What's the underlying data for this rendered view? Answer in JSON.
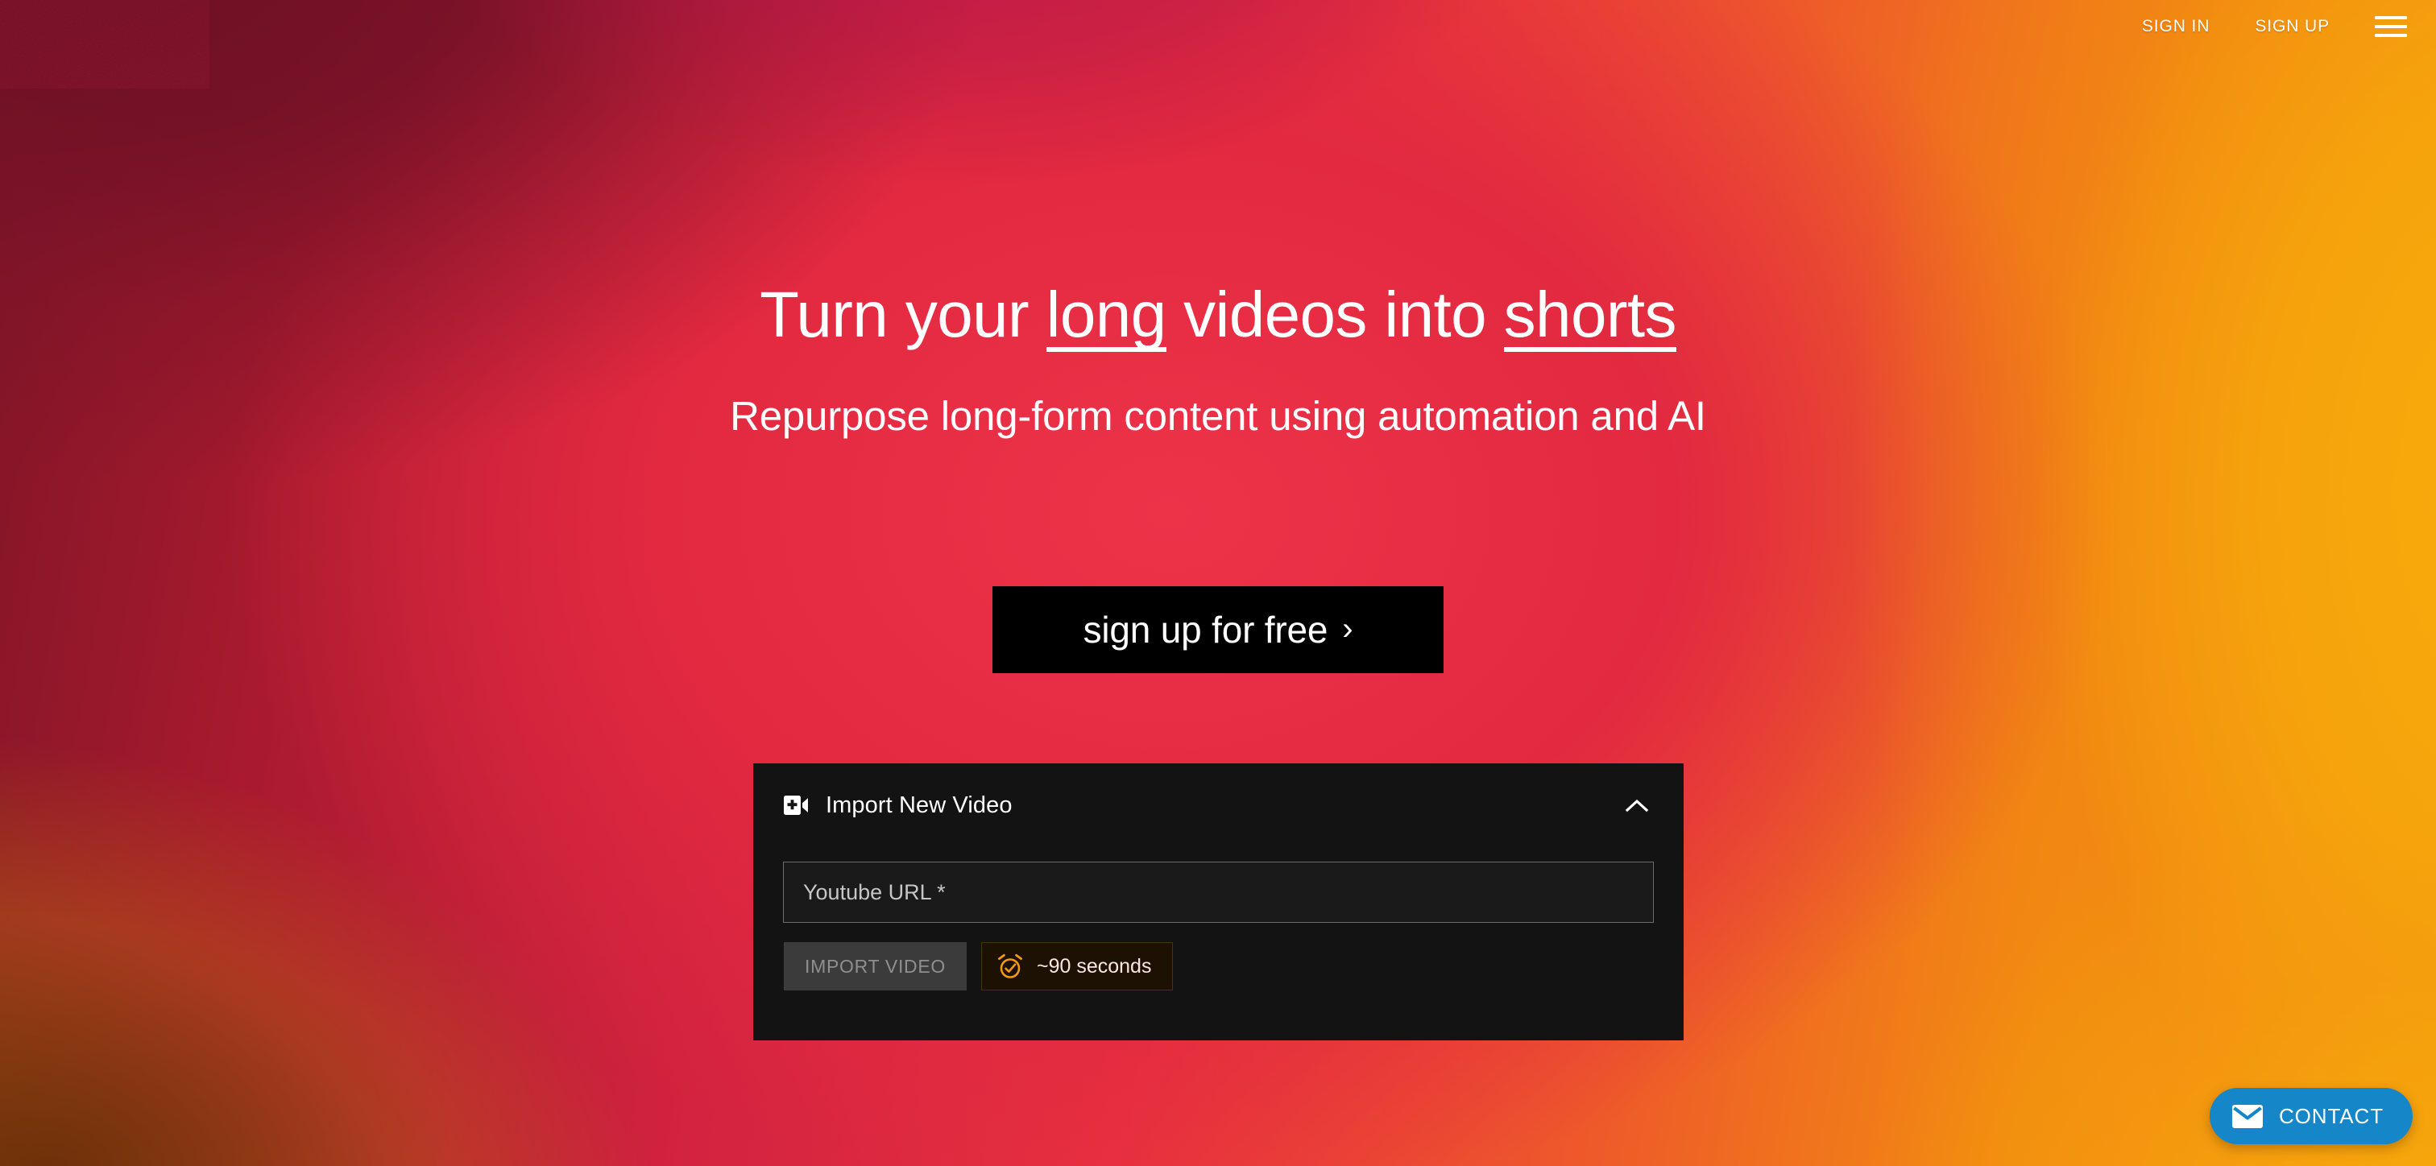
{
  "header": {
    "sign_in_label": "SIGN IN",
    "sign_up_label": "SIGN UP",
    "menu_icon": "hamburger-menu-icon"
  },
  "hero": {
    "headline_part1": "Turn your ",
    "headline_emphasis1": "long",
    "headline_part2": " videos into ",
    "headline_emphasis2": "shorts",
    "subheadline": "Repurpose long-form content using automation and AI",
    "cta_label": "sign up for free",
    "cta_chevron": "›"
  },
  "import_panel": {
    "title": "Import New Video",
    "title_icon": "video-plus-icon",
    "collapse_icon": "chevron-up-icon",
    "url_placeholder": "Youtube URL *",
    "url_value": "",
    "import_button_label": "IMPORT VIDEO",
    "import_button_disabled": true,
    "eta_icon": "alarm-clock-check-icon",
    "eta_label": "~90 seconds"
  },
  "contact_widget": {
    "label": "CONTACT",
    "icon": "envelope-icon"
  },
  "colors": {
    "background_crimson": "#E8283F",
    "background_maroon": "#6E1026",
    "background_amber": "#F6A50D",
    "background_ochre": "#8A4208",
    "panel_background": "#131313",
    "cta_background": "#000000",
    "eta_accent": "#F39A11",
    "contact_blue": "#1586C8",
    "text_white": "#FFFFFF"
  }
}
